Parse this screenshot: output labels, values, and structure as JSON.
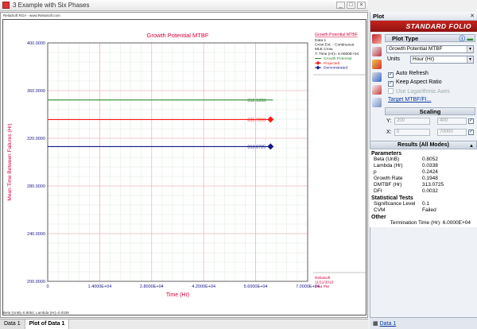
{
  "window": {
    "title": "3 Example with Six Phases",
    "buttons": [
      "_",
      "□",
      "×"
    ]
  },
  "plot": {
    "corner_top": "ReliaSoft RGA - www.ReliaSoft.com",
    "corner_bottom": "Beta (UnB)=0.8052, Lambda (Hr)=0.0338",
    "chart_data": {
      "type": "line",
      "title": "Growth Potential MTBF",
      "xlabel": "Time (Hr)",
      "ylabel": "Mean Time Between Failures (Hr)",
      "xlim": [
        0,
        70000
      ],
      "ylim": [
        200,
        400
      ],
      "x_ticks": [
        "0",
        "1.4000E+04",
        "2.8000E+04",
        "4.2000E+04",
        "5.6000E+04",
        "7.0000E+04"
      ],
      "y_ticks": [
        "200.0000",
        "240.0000",
        "280.0000",
        "320.0000",
        "360.0000",
        "400.0000"
      ],
      "grid": true,
      "series": [
        {
          "name": "Growth Potential",
          "color": "#2e8b2e",
          "marker": "none",
          "points": [
            [
              0,
              352.1283
            ],
            [
              60000,
              352.1283
            ]
          ],
          "label": "352.1283"
        },
        {
          "name": "Projected",
          "color": "#ff1a1a",
          "marker": "diamond",
          "points": [
            [
              0,
              335.7269
            ],
            [
              60000,
              335.7269
            ]
          ],
          "label": "335.7269"
        },
        {
          "name": "Demonstrated",
          "color": "#1a1a8c",
          "marker": "diamond",
          "points": [
            [
              0,
              313.0725
            ],
            [
              60000,
              313.0725
            ]
          ],
          "label": "313.0725"
        }
      ]
    },
    "legend": {
      "heading": "Growth Potential MTBF",
      "lines": [
        "Data 1",
        "Crow Ext. - Continuous",
        "MLE Crow",
        "T: Time (Hr)= 6.0000E+04"
      ],
      "entries": [
        "Growth Potential",
        "Projected",
        "Demonstrated"
      ]
    },
    "stamp": [
      "ReliaSoft",
      "11/11/2013",
      "2:54 PM"
    ]
  },
  "tabs": [
    "Data 1",
    "Plot of Data 1"
  ],
  "side": {
    "header": "Plot",
    "folio": "Standard Folio",
    "plot_type_title": "Plot Type",
    "plot_type_value": "Growth Potential MTBF",
    "units_label": "Units",
    "units_value": "Hour (Hr)",
    "auto_refresh": "Auto Refresh",
    "keep_aspect": "Keep Aspect Ratio",
    "log_axes": "Use Logarithmic Axes",
    "target_link": "Target MTBF/FI...",
    "scaling_title": "Scaling",
    "y_label": "Y:",
    "y_min": "200",
    "y_max": "400",
    "x_label": "X:",
    "x_min": "0",
    "x_max": "70000"
  },
  "results": {
    "title": "Results (All Modes)",
    "parameters_label": "Parameters",
    "parameters": [
      {
        "k": "Beta (UnB)",
        "v": "0.8052"
      },
      {
        "k": "Lambda (Hr)",
        "v": "0.0338"
      },
      {
        "k": "p",
        "v": "0.2424"
      },
      {
        "k": "Growth Rate",
        "v": "0.1948"
      },
      {
        "k": "DMTBF (Hr)",
        "v": "313.0725"
      },
      {
        "k": "DFI",
        "v": "0.0032"
      }
    ],
    "stats_label": "Statistical Tests",
    "stats": [
      {
        "k": "Significance Level",
        "v": "0.1"
      },
      {
        "k": "CVM",
        "v": "Failed"
      }
    ],
    "other_label": "Other",
    "termination": "Termination Time (Hr): 6.0000E+04"
  },
  "footer_link": "Data 1",
  "colors": {
    "accent": "#c6231f",
    "plot_text": "#d6003a",
    "tick_text": "#1a1a8c"
  }
}
